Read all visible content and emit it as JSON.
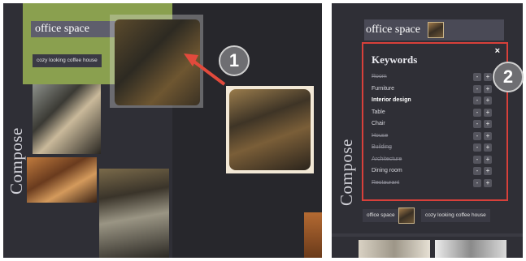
{
  "left_panel": {
    "compose_label": "Compose",
    "search_title": "office space",
    "tag_label": "cozy looking coffee house",
    "step_badge": "1"
  },
  "right_panel": {
    "compose_label": "Compose",
    "search_title": "office space",
    "step_badge": "2",
    "keywords": {
      "title": "Keywords",
      "close": "×",
      "items": [
        {
          "label": "Room",
          "style": "strike"
        },
        {
          "label": "Furniture",
          "style": "normal"
        },
        {
          "label": "Interior design",
          "style": "bold"
        },
        {
          "label": "Table",
          "style": "normal"
        },
        {
          "label": "Chair",
          "style": "normal"
        },
        {
          "label": "House",
          "style": "strike"
        },
        {
          "label": "Building",
          "style": "strike"
        },
        {
          "label": "Architecture",
          "style": "strike"
        },
        {
          "label": "Dining room",
          "style": "normal"
        },
        {
          "label": "Restaurant",
          "style": "strike"
        }
      ],
      "minus": "-",
      "plus": "+"
    },
    "bottom_tags": [
      "office space",
      "cozy looking coffee house"
    ]
  },
  "colors": {
    "accent_red": "#d8403a",
    "highlight_green": "#8aa04f",
    "panel_bg": "#2f2f36"
  }
}
